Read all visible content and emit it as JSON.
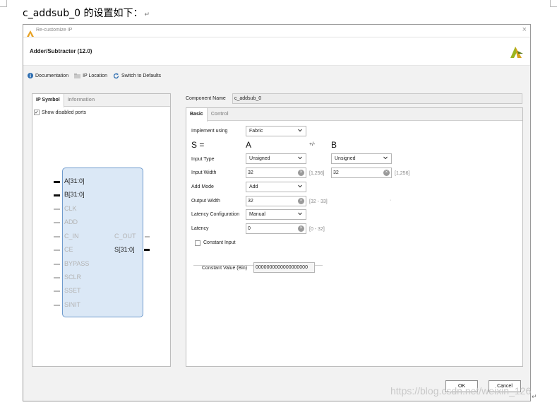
{
  "caption": "c_addsub_0 的设置如下：",
  "caption_return_mark": "↵",
  "footer_return_mark": "↵",
  "window": {
    "title": "Re-customize IP",
    "close_glyph": "×",
    "logo_color": "#e8a224"
  },
  "ip_name": "Adder/Subtracter (12.0)",
  "toolbar": {
    "documentation": "Documentation",
    "ip_location": "IP Location",
    "switch_defaults": "Switch to Defaults"
  },
  "left": {
    "tabs": [
      "IP Symbol",
      "Information"
    ],
    "show_disabled_ports": "Show disabled ports",
    "check_mark": "✓",
    "inputs": [
      {
        "name": "A[31:0]",
        "enabled": true
      },
      {
        "name": "B[31:0]",
        "enabled": true
      },
      {
        "name": "CLK",
        "enabled": false
      },
      {
        "name": "ADD",
        "enabled": false
      },
      {
        "name": "C_IN",
        "enabled": false
      },
      {
        "name": "CE",
        "enabled": false
      },
      {
        "name": "BYPASS",
        "enabled": false
      },
      {
        "name": "SCLR",
        "enabled": false
      },
      {
        "name": "SSET",
        "enabled": false
      },
      {
        "name": "SINIT",
        "enabled": false
      }
    ],
    "outputs": [
      {
        "name": "C_OUT",
        "enabled": false
      },
      {
        "name": "S[31:0]",
        "enabled": true
      }
    ]
  },
  "config": {
    "component_name_label": "Component Name",
    "component_name": "c_addsub_0",
    "tabs": [
      "Basic",
      "Control"
    ],
    "implement_label": "Implement using",
    "implement_value": "Fabric",
    "eq_s": "S =",
    "eq_a": "A",
    "eq_op": "+/-",
    "eq_b": "B",
    "input_type_label": "Input Type",
    "input_type_a": "Unsigned",
    "input_type_b": "Unsigned",
    "input_width_label": "Input Width",
    "input_width_a": "32",
    "input_width_a_range": "[1,256]",
    "input_width_b": "32",
    "input_width_b_range": "[1,256]",
    "add_mode_label": "Add Mode",
    "add_mode_value": "Add",
    "output_width_label": "Output Width",
    "output_width_value": "32",
    "output_width_range": "[32 - 33]",
    "stray_dot": "·",
    "latency_config_label": "Latency Configuration",
    "latency_config_value": "Manual",
    "latency_label": "Latency",
    "latency_value": "0",
    "latency_range": "[0 - 32]",
    "constant_input_label": "Constant Input",
    "constant_value_label": "Constant Value (Bin)",
    "constant_value": "0000000000000000000"
  },
  "buttons": {
    "ok": "OK",
    "cancel": "Cancel"
  },
  "watermark": "https://blog.csdn.net/weixin_126"
}
